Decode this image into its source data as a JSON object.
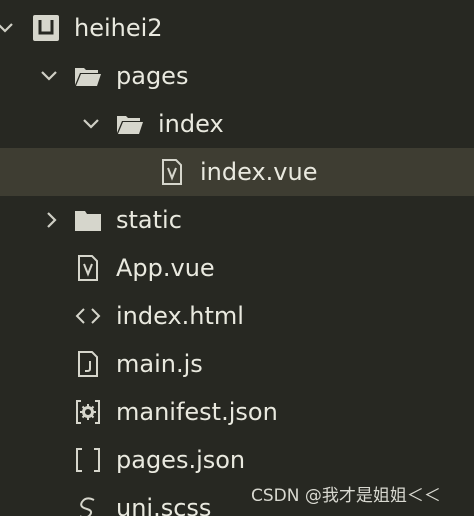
{
  "explorer": {
    "root": {
      "label": "heihei2",
      "icon": "project-icon",
      "expanded": true
    },
    "pages_folder": {
      "label": "pages",
      "icon": "folder-open-icon",
      "expanded": true
    },
    "index_folder": {
      "label": "index",
      "icon": "folder-open-icon",
      "expanded": true
    },
    "index_vue": {
      "label": "index.vue",
      "icon": "vue-file-icon",
      "selected": true
    },
    "static_folder": {
      "label": "static",
      "icon": "folder-closed-icon",
      "expanded": false
    },
    "app_vue": {
      "label": "App.vue",
      "icon": "vue-file-icon"
    },
    "index_html": {
      "label": "index.html",
      "icon": "html-file-icon"
    },
    "main_js": {
      "label": "main.js",
      "icon": "js-file-icon"
    },
    "manifest_json": {
      "label": "manifest.json",
      "icon": "manifest-file-icon"
    },
    "pages_json": {
      "label": "pages.json",
      "icon": "json-file-icon"
    },
    "uni_scss": {
      "label": "uni.scss",
      "icon": "scss-file-icon"
    }
  },
  "watermark": {
    "text": "CSDN @我才是姐姐＜＜"
  },
  "colors": {
    "background": "#272822",
    "selected_row": "#3e3d32",
    "text": "#e9e9df",
    "icon": "#d6d6cc"
  }
}
